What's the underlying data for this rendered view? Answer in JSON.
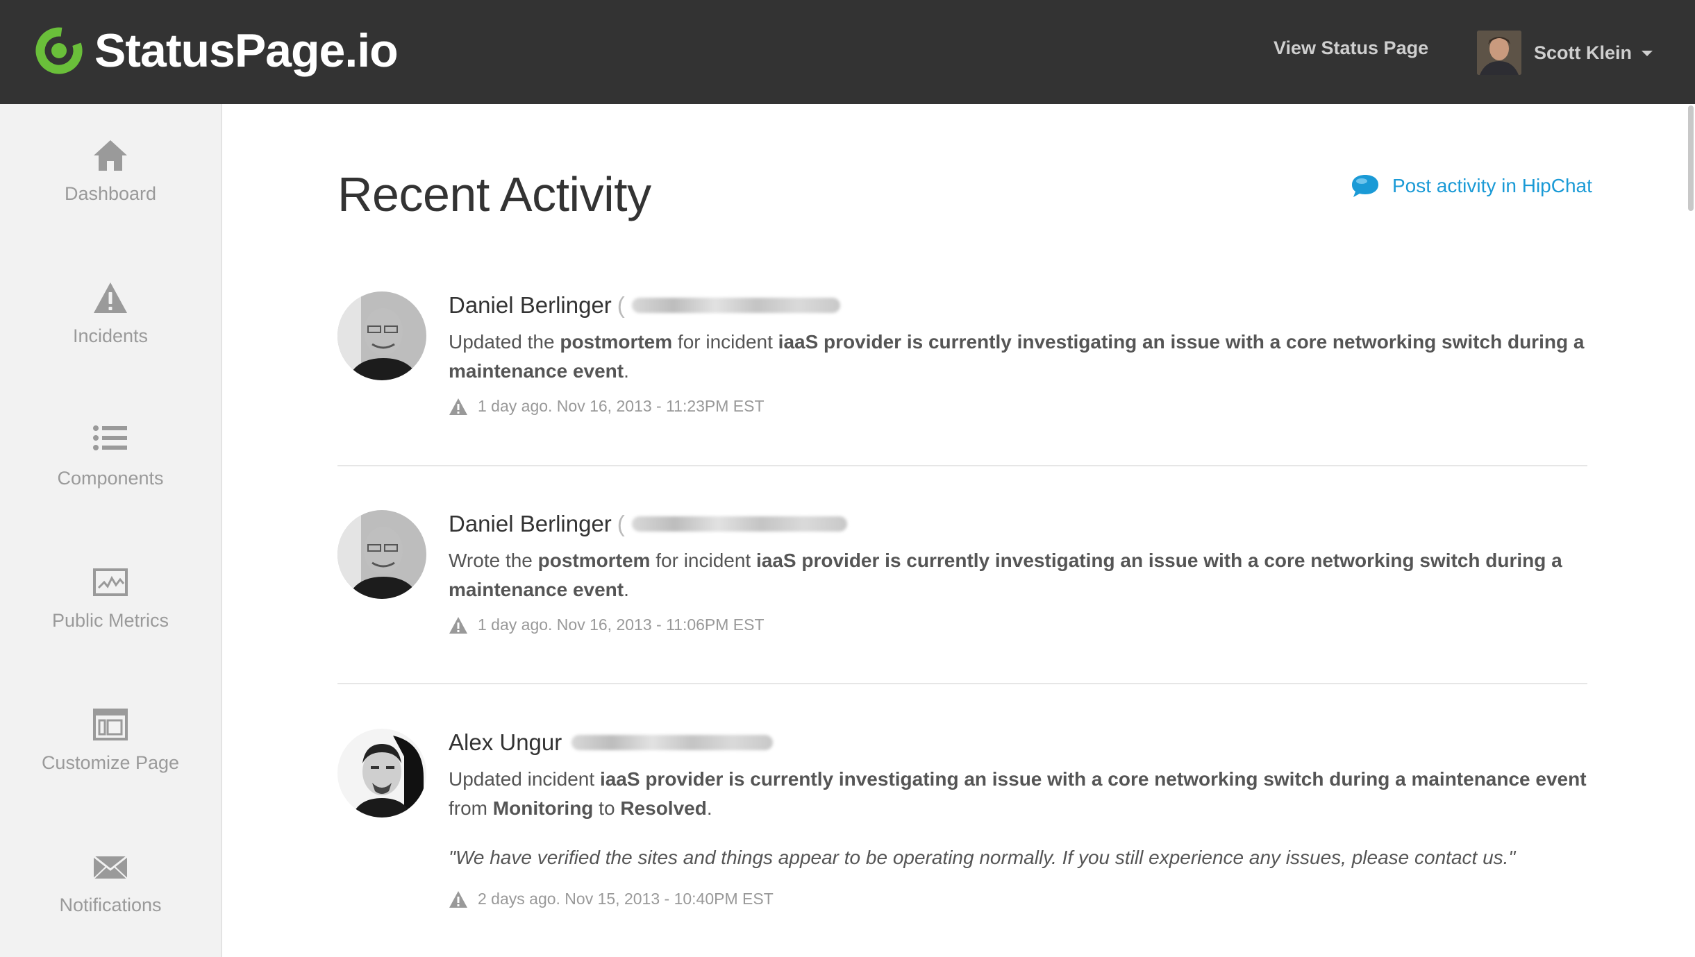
{
  "app": {
    "logo_text": "StatusPage.io",
    "brand_color": "#6abf3a",
    "topbar_color": "#333333",
    "link_color": "#1a9ad6"
  },
  "header": {
    "view_status_page": "View Status Page",
    "user_name": "Scott Klein"
  },
  "sidebar": {
    "items": [
      {
        "label": "Dashboard",
        "icon": "home-icon"
      },
      {
        "label": "Incidents",
        "icon": "warning-icon"
      },
      {
        "label": "Components",
        "icon": "list-icon"
      },
      {
        "label": "Public Metrics",
        "icon": "metrics-chart-icon"
      },
      {
        "label": "Customize Page",
        "icon": "layout-icon"
      },
      {
        "label": "Notifications",
        "icon": "envelope-icon"
      }
    ]
  },
  "main": {
    "title": "Recent Activity",
    "hipchat_link": "Post activity in HipChat",
    "activities": [
      {
        "name": "Daniel Berlinger",
        "paren": "(",
        "verb": "Updated the ",
        "object": "postmortem",
        "mid": " for incident ",
        "incident": "iaaS provider is currently investigating an issue with a core networking switch during a maintenance event",
        "end": ".",
        "meta": "1 day ago. Nov 16, 2013 - 11:23PM EST"
      },
      {
        "name": "Daniel Berlinger",
        "paren": "(",
        "verb": "Wrote the ",
        "object": "postmortem",
        "mid": " for incident ",
        "incident": "iaaS provider is currently investigating an issue with a core networking switch during a maintenance event",
        "end": ".",
        "meta": "1 day ago. Nov 16, 2013 - 11:06PM EST"
      },
      {
        "name": "Alex Ungur",
        "verb": "Updated incident ",
        "incident": "iaaS provider is currently investigating an issue with a core networking switch during a maintenance event",
        "from_label": " from ",
        "from_status": "Monitoring",
        "to_label": " to ",
        "to_status": "Resolved",
        "end": ".",
        "quote": "\"We have verified the sites and things appear to be operating normally. If you still experience any issues, please contact us.\"",
        "meta": "2 days ago. Nov 15, 2013 - 10:40PM EST"
      }
    ]
  }
}
